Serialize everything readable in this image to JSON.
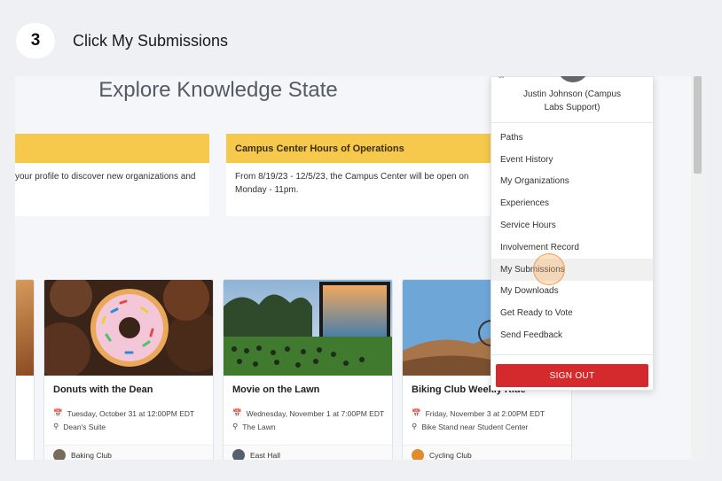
{
  "step": {
    "number": "3",
    "instruction": "Click My Submissions"
  },
  "page": {
    "title": "Explore Knowledge State"
  },
  "announcements": [
    {
      "title": "",
      "body": "your profile to discover new organizations and"
    },
    {
      "title": "Campus Center Hours of Operations",
      "body": "From 8/19/23 - 12/5/23, the Campus Center will be open on Monday - 11pm."
    }
  ],
  "events": [
    {
      "title": "Donuts with the Dean",
      "datetime": "Tuesday, October 31 at 12:00PM EDT",
      "location": "Dean's Suite",
      "org": "Baking Club"
    },
    {
      "title": "Movie on the Lawn",
      "datetime": "Wednesday, November 1 at 7:00PM EDT",
      "location": "The Lawn",
      "org": "East Hall"
    },
    {
      "title": "Biking Club Weekly Ride",
      "datetime": "Friday, November 3 at 2:00PM EDT",
      "location": "Bike Stand near Student Center",
      "org": "Cycling Club"
    }
  ],
  "menu": {
    "user_name": "Justin Johnson (Campus Labs Support)",
    "items": [
      "Paths",
      "Event History",
      "My Organizations",
      "Experiences",
      "Service Hours",
      "Involvement Record",
      "My Submissions",
      "My Downloads",
      "Get Ready to Vote",
      "Send Feedback"
    ],
    "sign_out": "SIGN OUT"
  },
  "colors": {
    "accent_yellow": "#f6c84c",
    "sign_out_red": "#d52a2d"
  }
}
